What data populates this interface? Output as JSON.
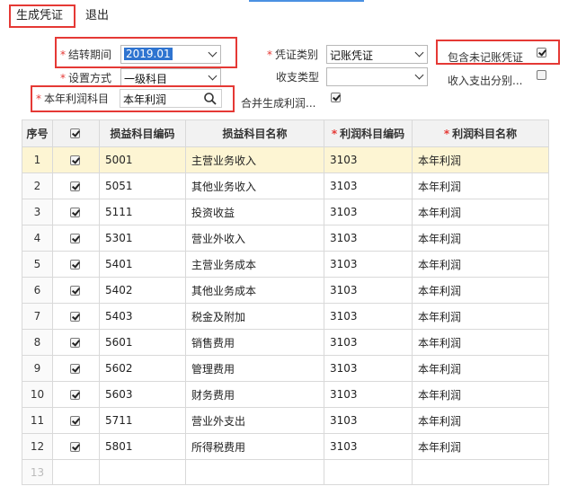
{
  "toolbar": {
    "generate_label": "生成凭证",
    "exit_label": "退出"
  },
  "form": {
    "period_label": "结转期间",
    "period_value": "2019.01",
    "setup_label": "设置方式",
    "setup_value": "一级科目",
    "profit_subject_label": "本年利润科目",
    "profit_subject_value": "本年利润",
    "voucher_type_label": "凭证类别",
    "voucher_type_value": "记账凭证",
    "income_type_label": "收支类型",
    "income_type_value": "",
    "merge_label": "合并生成利润...",
    "merge_checked": true,
    "include_unposted_label": "包含未记账凭证",
    "include_unposted_checked": true,
    "split_label": "收入支出分别...",
    "split_checked": false
  },
  "table": {
    "headers": [
      "序号",
      "",
      "损益科目编码",
      "损益科目名称",
      "利润科目编码",
      "利润科目名称"
    ],
    "rows": [
      {
        "seq": "1",
        "checked": true,
        "code": "5001",
        "name": "主营业务收入",
        "profit_code": "3103",
        "profit_name": "本年利润"
      },
      {
        "seq": "2",
        "checked": true,
        "code": "5051",
        "name": "其他业务收入",
        "profit_code": "3103",
        "profit_name": "本年利润"
      },
      {
        "seq": "3",
        "checked": true,
        "code": "5111",
        "name": "投资收益",
        "profit_code": "3103",
        "profit_name": "本年利润"
      },
      {
        "seq": "4",
        "checked": true,
        "code": "5301",
        "name": "营业外收入",
        "profit_code": "3103",
        "profit_name": "本年利润"
      },
      {
        "seq": "5",
        "checked": true,
        "code": "5401",
        "name": "主营业务成本",
        "profit_code": "3103",
        "profit_name": "本年利润"
      },
      {
        "seq": "6",
        "checked": true,
        "code": "5402",
        "name": "其他业务成本",
        "profit_code": "3103",
        "profit_name": "本年利润"
      },
      {
        "seq": "7",
        "checked": true,
        "code": "5403",
        "name": "税金及附加",
        "profit_code": "3103",
        "profit_name": "本年利润"
      },
      {
        "seq": "8",
        "checked": true,
        "code": "5601",
        "name": "销售费用",
        "profit_code": "3103",
        "profit_name": "本年利润"
      },
      {
        "seq": "9",
        "checked": true,
        "code": "5602",
        "name": "管理费用",
        "profit_code": "3103",
        "profit_name": "本年利润"
      },
      {
        "seq": "10",
        "checked": true,
        "code": "5603",
        "name": "财务费用",
        "profit_code": "3103",
        "profit_name": "本年利润"
      },
      {
        "seq": "11",
        "checked": true,
        "code": "5711",
        "name": "营业外支出",
        "profit_code": "3103",
        "profit_name": "本年利润"
      },
      {
        "seq": "12",
        "checked": true,
        "code": "5801",
        "name": "所得税费用",
        "profit_code": "3103",
        "profit_name": "本年利润"
      }
    ],
    "empty_row_seq": "13"
  },
  "colors": {
    "required": "#e53935",
    "highlight_box": "#e53935",
    "selected_row": "#fdf5d3",
    "selection": "#2f74d0"
  },
  "icons": {
    "search": "search-icon",
    "dropdown": "chevron-down-icon",
    "checkbox": "checkbox-icon"
  }
}
